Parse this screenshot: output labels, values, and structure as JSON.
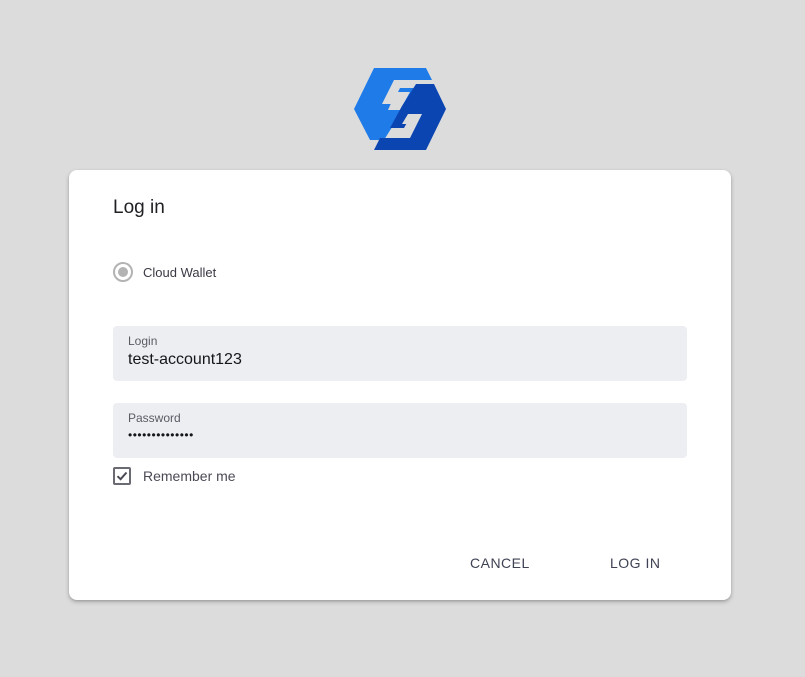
{
  "logo": {
    "icon": "app-logo-icon",
    "colors": [
      "#1f7be8",
      "#0b45b2"
    ]
  },
  "dialog": {
    "title": "Log in",
    "wallet_option": {
      "label": "Cloud Wallet",
      "selected": true
    },
    "login_field": {
      "label": "Login",
      "value": "test-account123"
    },
    "password_field": {
      "label": "Password",
      "value": "••••••••••••••"
    },
    "remember": {
      "label": "Remember me",
      "checked": true
    },
    "buttons": {
      "cancel": "CANCEL",
      "login": "LOG IN"
    }
  },
  "colors": {
    "background": "#dcdcdd",
    "card": "#ffffff",
    "field_bg": "#edeef1",
    "button_text": "#3f4253"
  }
}
